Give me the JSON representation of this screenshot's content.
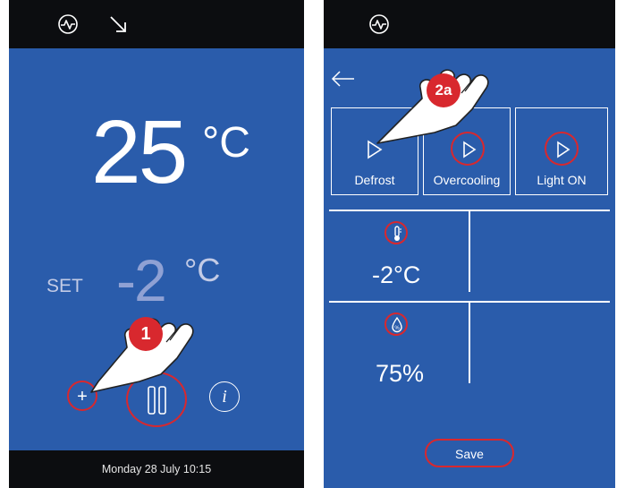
{
  "left_screen": {
    "current_temp": "25",
    "current_unit": "°C",
    "set_label": "SET",
    "set_value": "-2",
    "set_unit": "°C",
    "plus_symbol": "+",
    "info_symbol": "i",
    "footer_datetime": "Monday 28 July 10:15",
    "callout_number": "1"
  },
  "right_screen": {
    "modes": [
      {
        "label": "Defrost"
      },
      {
        "label": "Overcooling"
      },
      {
        "label": "Light ON"
      }
    ],
    "temperature_setting": "-2°C",
    "humidity_setting": "75%",
    "save_label": "Save",
    "callout_number": "2a"
  },
  "colors": {
    "screen_blue": "#2a5cab",
    "bar_black": "#0c0d10",
    "highlight_red": "#d8282e"
  },
  "icons": [
    "pulse-icon",
    "arrow-down-right-icon",
    "back-arrow-icon",
    "play-icon",
    "thermometer-icon",
    "humidity-drop-icon",
    "pointing-hand-icon",
    "pause-icon",
    "info-icon",
    "plus-icon"
  ]
}
